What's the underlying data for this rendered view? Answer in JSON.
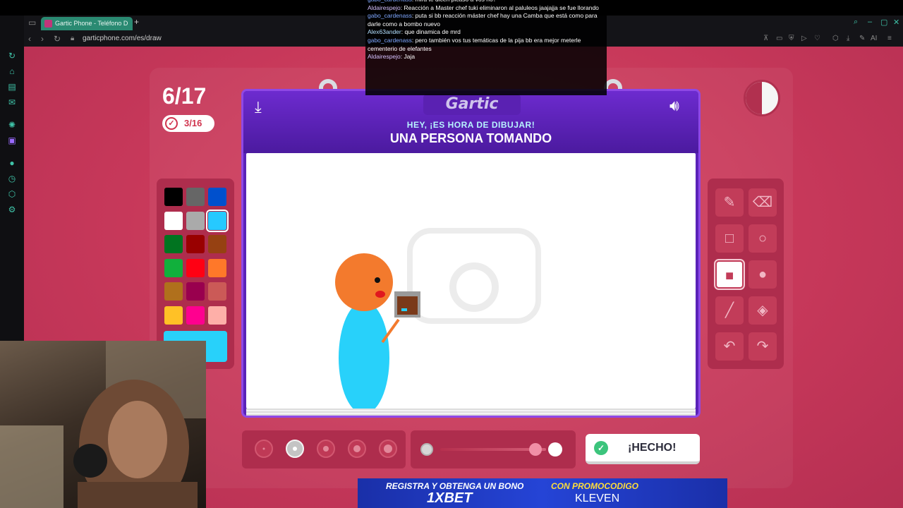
{
  "browser": {
    "tab_title": "Gartic Phone - Teléfono D",
    "url": "garticphone.com/es/draw"
  },
  "chat": {
    "messages": [
      {
        "user": "gabo_cardenass",
        "text": ": mira te dicen picaso a vos no?"
      },
      {
        "user": "Aldairespejo",
        "text": ": Reacción a Master chef tuki eliminaron al paluleos jaajajja se fue llorando"
      },
      {
        "user": "gabo_cardenass",
        "text": ": puta si bb reacción máster chef hay una Camba que está como para darle como a bombo nuevo"
      },
      {
        "user": "Alex63ander",
        "text": ": que dinamica de mrd"
      },
      {
        "user": "gabo_cardenass",
        "text": ": pero también vos tus temáticas de la pija bb era mejor meterle cementerio de elefantes"
      },
      {
        "user": "Aldairespejo",
        "text": ": Jaja"
      }
    ]
  },
  "game": {
    "counter": "6/17",
    "rounds_badge": "3/16",
    "logo": "Gartic",
    "hey_text": "HEY, ¡ES HORA DE DIBUJAR!",
    "prompt": "UNA PERSONA TOMANDO",
    "done_label": "¡HECHO!",
    "timer_remaining_fraction": 0.5
  },
  "palette": {
    "colors": [
      "#000000",
      "#666666",
      "#0050cd",
      "#ffffff",
      "#aaaaaa",
      "#26c9ff",
      "#017420",
      "#990000",
      "#964112",
      "#11b03c",
      "#ff0013",
      "#ff7829",
      "#b0701c",
      "#99004e",
      "#cb5a57",
      "#ffc126",
      "#ff008f",
      "#feafa8"
    ],
    "selected_index": 5,
    "current_color": "#28d1fa"
  },
  "tools": [
    {
      "name": "pencil-tool",
      "icon": "pencil-icon",
      "glyph": "✎"
    },
    {
      "name": "eraser-tool",
      "icon": "eraser-icon",
      "glyph": "⌫"
    },
    {
      "name": "rectangle-tool",
      "icon": "rectangle-outline-icon",
      "glyph": "□"
    },
    {
      "name": "ellipse-tool",
      "icon": "ellipse-outline-icon",
      "glyph": "○"
    },
    {
      "name": "filled-rectangle-tool",
      "icon": "filled-rectangle-icon",
      "glyph": "■"
    },
    {
      "name": "filled-ellipse-tool",
      "icon": "filled-ellipse-icon",
      "glyph": "●"
    },
    {
      "name": "line-tool",
      "icon": "line-icon",
      "glyph": "╱"
    },
    {
      "name": "fill-bucket-tool",
      "icon": "fill-bucket-icon",
      "glyph": "◈"
    },
    {
      "name": "undo-tool",
      "icon": "undo-icon",
      "glyph": "↶"
    },
    {
      "name": "redo-tool",
      "icon": "redo-icon",
      "glyph": "↷"
    }
  ],
  "brush_sizes": {
    "count": 5,
    "selected_index": 1
  },
  "opacity": {
    "value": 1.0
  },
  "ad": {
    "line1": "REGISTRA Y OBTENGA UN BONO",
    "brand": "1XBET",
    "promo_label": "CON PROMOCODIGO",
    "promo_code": "KLEVEN"
  }
}
